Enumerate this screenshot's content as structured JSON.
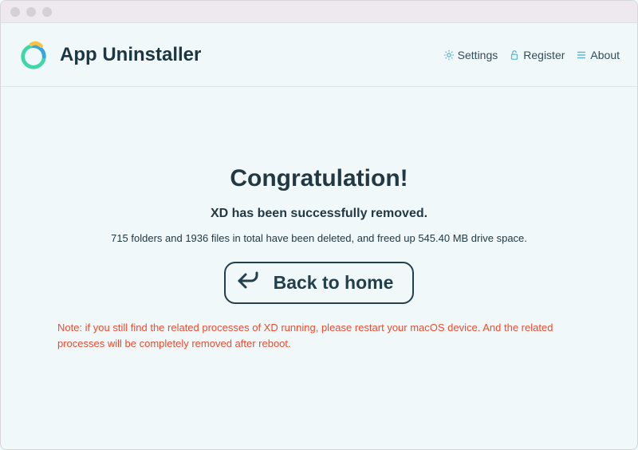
{
  "header": {
    "app_title": "App Uninstaller",
    "menu": {
      "settings": "Settings",
      "register": "Register",
      "about": "About"
    }
  },
  "main": {
    "title": "Congratulation!",
    "success_message": "XD has been successfully removed.",
    "stats_message": "715 folders and 1936 files in total have been deleted, and freed up 545.40 MB drive space.",
    "back_button": "Back to home",
    "note": "Note: if you still find the related processes of XD running, please restart your macOS device. And the related processes will be completely removed after reboot."
  }
}
